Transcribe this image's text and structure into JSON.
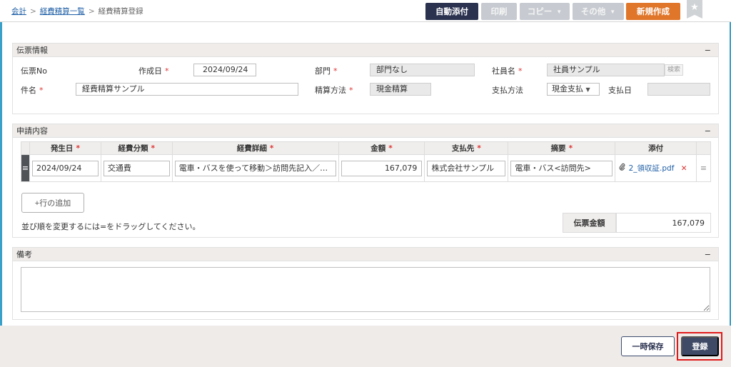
{
  "breadcrumb": {
    "root": "会計",
    "list": "経費精算一覧",
    "current": "経費精算登録",
    "sep": ">"
  },
  "toolbar": {
    "auto_attach": "自動添付",
    "print": "印刷",
    "copy": "コピー",
    "other": "その他",
    "create": "新規作成",
    "caret": "▼",
    "star": "★"
  },
  "slip": {
    "title": "伝票情報",
    "collapse": "−",
    "no_label": "伝票No",
    "created_label": "作成日",
    "created_value": "2024/09/24",
    "dept_label": "部門",
    "dept_value": "部門なし",
    "employee_label": "社員名",
    "employee_value": "社員サンプル",
    "search": "検索",
    "subject_label": "件名",
    "subject_value": "経費精算サンプル",
    "method_label": "精算方法",
    "method_value": "現金精算",
    "pay_method_label": "支払方法",
    "pay_method_value": "現金支払",
    "pay_date_label": "支払日",
    "pay_date_value": "",
    "req": "*"
  },
  "request": {
    "title": "申請内容",
    "collapse": "−",
    "columns": [
      "発生日",
      "経費分類",
      "経費詳細",
      "金額",
      "支払先",
      "摘要",
      "添付"
    ],
    "rows": [
      {
        "date": "2024/09/24",
        "category": "交通費",
        "detail": "電車・バスを使って移動＞訪問先記入／…",
        "amount": "167,079",
        "payee": "株式会社サンプル",
        "summary": "電車・バス<訪問先>",
        "attachment": "2_領収証.pdf",
        "remove": "✕"
      }
    ],
    "drag_glyph": "≡",
    "add_row": "+行の追加",
    "hint": "並び順を変更するには=をドラッグしてください。",
    "total_label": "伝票金額",
    "total_value": "167,079"
  },
  "memo": {
    "title": "備考",
    "collapse": "−"
  },
  "footer": {
    "draft": "一時保存",
    "submit": "登録"
  }
}
